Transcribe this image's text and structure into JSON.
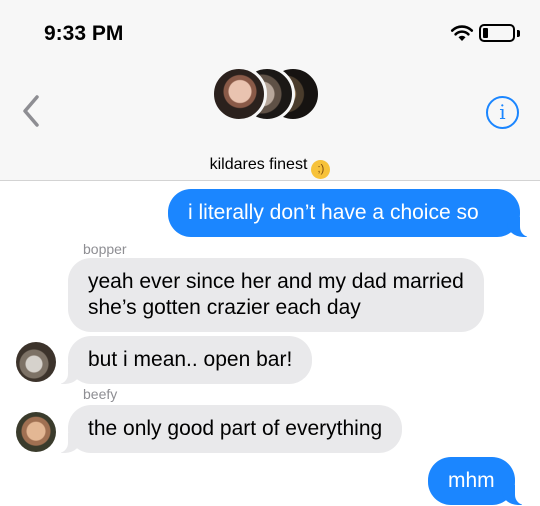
{
  "status_bar": {
    "time": "9:33 PM"
  },
  "nav": {
    "group_name": "kildares finest",
    "group_emoji": "😉"
  },
  "messages": [
    {
      "direction": "outgoing",
      "text": "i literally don’t have a choice so"
    },
    {
      "direction": "incoming",
      "sender": "bopper",
      "text": "yeah ever since her and my dad married she’s gotten crazier each day"
    },
    {
      "direction": "incoming",
      "sender": "bopper",
      "text": "but i mean.. open bar!"
    },
    {
      "direction": "incoming",
      "sender": "beefy",
      "text": "the only good part of everything"
    },
    {
      "direction": "outgoing",
      "text": "mhm"
    }
  ],
  "colors": {
    "accent": "#1b86ff",
    "incoming_bubble": "#e9e9eb",
    "header_bg": "#f7f7f7"
  }
}
